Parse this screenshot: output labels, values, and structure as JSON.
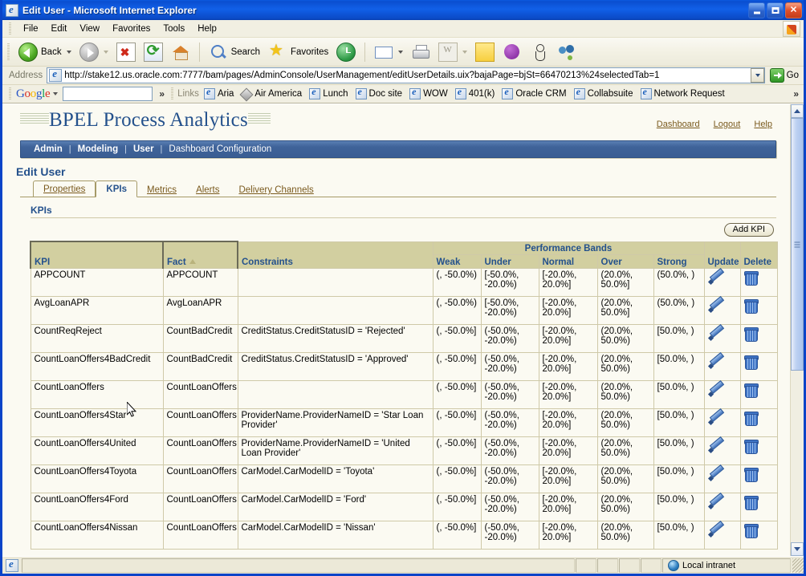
{
  "window": {
    "title": "Edit User - Microsoft Internet Explorer",
    "icon": "ie-page-icon",
    "minimize": "minimize-button",
    "maximize": "maximize-button",
    "close": "close-button"
  },
  "menu": {
    "items": [
      "File",
      "Edit",
      "View",
      "Favorites",
      "Tools",
      "Help"
    ]
  },
  "toolbar": {
    "back": "Back",
    "forward": "",
    "stop": "",
    "refresh": "",
    "home": "",
    "search": "Search",
    "favorites": "Favorites",
    "history": "",
    "mail": "",
    "print": "",
    "edit": "",
    "notes": "",
    "messenger": "",
    "person": "",
    "people": ""
  },
  "address": {
    "label": "Address",
    "url": "http://stake12.us.oracle.com:7777/bam/pages/AdminConsole/UserManagement/editUserDetails.uix?bajaPage=bjSt=66470213%24selectedTab=1",
    "go_label": "Go"
  },
  "googlebar": {
    "logo": "Google",
    "search_value": "",
    "chevron": "»"
  },
  "links": {
    "label": "Links",
    "items": [
      {
        "label": "Aria",
        "icon": "ie-page-icon"
      },
      {
        "label": "Air America",
        "icon": "diamond-icon"
      },
      {
        "label": "Lunch",
        "icon": "ie-page-icon"
      },
      {
        "label": "Doc site",
        "icon": "ie-page-icon"
      },
      {
        "label": "WOW",
        "icon": "ie-page-icon"
      },
      {
        "label": "401(k)",
        "icon": "ie-page-icon"
      },
      {
        "label": "Oracle CRM",
        "icon": "ie-page-icon"
      },
      {
        "label": "Collabsuite",
        "icon": "ie-page-icon"
      },
      {
        "label": "Network Request",
        "icon": "ie-page-icon"
      }
    ],
    "overflow": "»"
  },
  "app": {
    "brand": "BPEL Process Analytics",
    "header_links": [
      "Dashboard",
      "Logout",
      "Help"
    ],
    "nav": [
      {
        "label": "Admin",
        "active": false
      },
      {
        "label": "Modeling",
        "active": false
      },
      {
        "label": "User",
        "active": true
      },
      {
        "label": "Dashboard Configuration",
        "active": false
      }
    ],
    "nav_separator": "|",
    "page_title": "Edit User",
    "tabs": [
      {
        "label": "Properties",
        "active": false
      },
      {
        "label": "KPIs",
        "active": true
      },
      {
        "label": "Metrics",
        "active": false
      },
      {
        "label": "Alerts",
        "active": false
      },
      {
        "label": "Delivery Channels",
        "active": false
      }
    ],
    "section_title": "KPIs",
    "add_kpi_label": "Add KPI"
  },
  "table": {
    "group_header": "Performance Bands",
    "columns": [
      "KPI",
      "Fact",
      "Constraints",
      "Weak",
      "Under",
      "Normal",
      "Over",
      "Strong",
      "Update",
      "Delete"
    ],
    "sort_column": "Fact",
    "sort_direction": "ascending",
    "rows": [
      {
        "kpi": "APPCOUNT",
        "fact": "APPCOUNT",
        "constraints": "",
        "weak": "(, -50.0%)",
        "under": "[-50.0%, -20.0%)",
        "normal": "[-20.0%, 20.0%]",
        "over": "(20.0%, 50.0%]",
        "strong": "(50.0%, )"
      },
      {
        "kpi": "AvgLoanAPR",
        "fact": "AvgLoanAPR",
        "constraints": "",
        "weak": "(, -50.0%)",
        "under": "[-50.0%, -20.0%)",
        "normal": "[-20.0%, 20.0%]",
        "over": "(20.0%, 50.0%]",
        "strong": "(50.0%, )"
      },
      {
        "kpi": "CountReqReject",
        "fact": "CountBadCredit",
        "constraints": "CreditStatus.CreditStatusID = 'Rejected'",
        "weak": "(, -50.0%]",
        "under": "(-50.0%, -20.0%)",
        "normal": "[-20.0%, 20.0%]",
        "over": "(20.0%, 50.0%)",
        "strong": "[50.0%, )"
      },
      {
        "kpi": "CountLoanOffers4BadCredit",
        "fact": "CountBadCredit",
        "constraints": "CreditStatus.CreditStatusID = 'Approved'",
        "weak": "(, -50.0%]",
        "under": "(-50.0%, -20.0%)",
        "normal": "[-20.0%, 20.0%]",
        "over": "(20.0%, 50.0%)",
        "strong": "[50.0%, )"
      },
      {
        "kpi": "CountLoanOffers",
        "fact": "CountLoanOffers",
        "constraints": "",
        "weak": "(, -50.0%]",
        "under": "(-50.0%, -20.0%)",
        "normal": "[-20.0%, 20.0%]",
        "over": "(20.0%, 50.0%)",
        "strong": "[50.0%, )"
      },
      {
        "kpi": "CountLoanOffers4Star",
        "fact": "CountLoanOffers",
        "constraints": "ProviderName.ProviderNameID = 'Star Loan Provider'",
        "weak": "(, -50.0%]",
        "under": "(-50.0%, -20.0%)",
        "normal": "[-20.0%, 20.0%]",
        "over": "(20.0%, 50.0%)",
        "strong": "[50.0%, )"
      },
      {
        "kpi": "CountLoanOffers4United",
        "fact": "CountLoanOffers",
        "constraints": "ProviderName.ProviderNameID = 'United Loan Provider'",
        "weak": "(, -50.0%]",
        "under": "(-50.0%, -20.0%)",
        "normal": "[-20.0%, 20.0%]",
        "over": "(20.0%, 50.0%)",
        "strong": "[50.0%, )"
      },
      {
        "kpi": "CountLoanOffers4Toyota",
        "fact": "CountLoanOffers",
        "constraints": "CarModel.CarModelID = 'Toyota'",
        "weak": "(, -50.0%]",
        "under": "(-50.0%, -20.0%)",
        "normal": "[-20.0%, 20.0%]",
        "over": "(20.0%, 50.0%)",
        "strong": "[50.0%, )"
      },
      {
        "kpi": "CountLoanOffers4Ford",
        "fact": "CountLoanOffers",
        "constraints": "CarModel.CarModelID = 'Ford'",
        "weak": "(, -50.0%]",
        "under": "(-50.0%, -20.0%)",
        "normal": "[-20.0%, 20.0%]",
        "over": "(20.0%, 50.0%)",
        "strong": "[50.0%, )"
      },
      {
        "kpi": "CountLoanOffers4Nissan",
        "fact": "CountLoanOffers",
        "constraints": "CarModel.CarModelID = 'Nissan'",
        "weak": "(, -50.0%]",
        "under": "(-50.0%, -20.0%)",
        "normal": "[-20.0%, 20.0%]",
        "over": "(20.0%, 50.0%)",
        "strong": "[50.0%, )"
      }
    ]
  },
  "statusbar": {
    "message": "",
    "zone": "Local intranet"
  },
  "colors": {
    "titlebar": "#0b4ac6",
    "page_bg": "#fbfaf2",
    "nav_bar": "#3f6399",
    "table_header": "#d2cfa0",
    "heading_blue": "#24518c",
    "link_brown": "#7a5a1e"
  }
}
